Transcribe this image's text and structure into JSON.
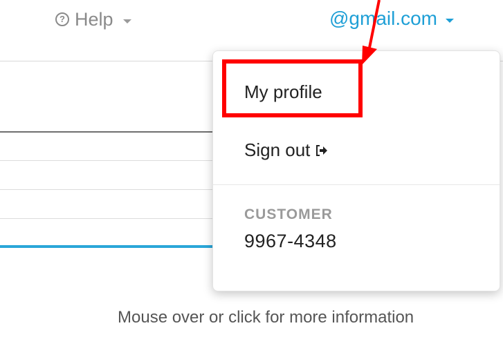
{
  "header": {
    "help_label": "Help",
    "help_icon": "question-circle-icon",
    "account_label": "@gmail.com"
  },
  "dropdown": {
    "my_profile_label": "My profile",
    "sign_out_label": "Sign out",
    "sign_out_icon": "sign-out-icon",
    "customer_heading": "CUSTOMER",
    "customer_number": "9967-4348"
  },
  "footer": {
    "hint": "Mouse over or click for more information"
  },
  "annotation": {
    "color": "#ff0000"
  },
  "colors": {
    "accent": "#1e9fd6",
    "muted": "#8a8a8a"
  }
}
